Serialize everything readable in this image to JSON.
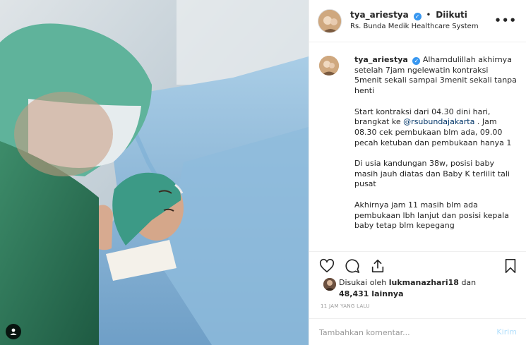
{
  "post": {
    "username": "tya_ariestya",
    "separator": "•",
    "follow_status": "Diikuti",
    "location": "Rs. Bunda Medik Healthcare System",
    "more_glyph": "•••"
  },
  "caption": {
    "username": "tya_ariestya",
    "p1": "Alhamdulillah akhirnya setelah 7jam ngelewatin kontraksi 5menit sekali sampai 3menit sekali tanpa henti",
    "p2_before": "Start kontraksi dari 04.30 dini hari, brangkat ke ",
    "p2_mention": "@rsubundajakarta",
    "p2_after": " . Jam 08.30 cek pembukaan blm ada, 09.00 pecah ketuban dan pembukaan hanya 1",
    "p3": "Di usia kandungan 38w, posisi baby masih jauh diatas dan Baby K terlilit tali pusat",
    "p4": "Akhirnya jam 11 masih blm ada pembukaan lbh lanjut dan posisi kepala baby tetap blm kepegang"
  },
  "likes": {
    "prefix": "Disukai oleh",
    "liker": "lukmanazhari18",
    "conjunction": "dan",
    "count": "48,431",
    "suffix": "lainnya"
  },
  "timestamp": "11 JAM YANG LALU",
  "comment_box": {
    "placeholder": "Tambahkan komentar...",
    "post_label": "Kirim"
  },
  "icons": {
    "like": "heart-icon",
    "comment": "comment-bubble-icon",
    "share": "share-upload-icon",
    "save": "bookmark-icon",
    "more": "more-options-icon",
    "tag": "user-tag-icon",
    "verified": "verified-badge-icon"
  },
  "colors": {
    "verified_blue": "#3897f0",
    "mention_link": "#003569",
    "post_button_disabled": "#b2dffc",
    "muted_text": "#999999"
  }
}
